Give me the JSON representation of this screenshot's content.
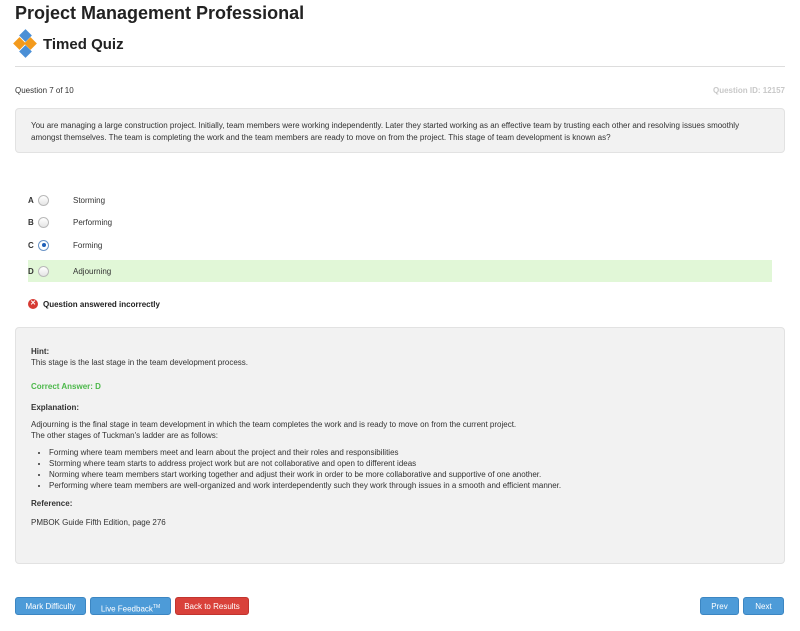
{
  "header": {
    "app_title": "Project Management Professional",
    "quiz_title": "Timed Quiz"
  },
  "question": {
    "counter": "Question 7 of 10",
    "id": "Question ID: 12157",
    "text": "You are managing a large construction project. Initially, team members were working independently. Later they started working as an effective team by trusting each other and resolving issues smoothly amongst themselves. The team is completing the work and the team members are ready to move on from the project. This stage of team development is known as?"
  },
  "options": [
    {
      "letter": "A",
      "label": "Storming",
      "selected": false,
      "correct": false
    },
    {
      "letter": "B",
      "label": "Performing",
      "selected": false,
      "correct": false
    },
    {
      "letter": "C",
      "label": "Forming",
      "selected": true,
      "correct": false
    },
    {
      "letter": "D",
      "label": "Adjourning",
      "selected": false,
      "correct": true
    }
  ],
  "feedback": {
    "icon": "x-circle-icon",
    "text": "Question answered incorrectly"
  },
  "hint": {
    "label": "Hint:",
    "text": "This stage is the last stage in the team development process.",
    "correct_answer": "Correct Answer: D",
    "explanation_label": "Explanation:",
    "explanation_line1": "Adjourning is the final stage in team development in which the team completes the work and is ready to move on from the current project.",
    "explanation_line2": "The other stages of Tuckman's ladder are as follows:",
    "bullets": [
      "Forming where team members meet and learn about the project and their roles and responsibilities",
      "Storming where team starts to address project work but are not collaborative and open to different ideas",
      "Norming where team members start working together and adjust their work in order to be more collaborative and supportive of one another.",
      "Performing where team members are well-organized and work interdependently such they work through issues in a smooth and efficient manner."
    ],
    "reference_label": "Reference:",
    "reference_text": "PMBOK Guide Fifth Edition, page 276"
  },
  "buttons": {
    "mark_difficulty": "Mark Difficulty",
    "live_feedback": "Live Feedback",
    "live_feedback_tm": "TM",
    "back_to_results": "Back to Results",
    "prev": "Prev",
    "next": "Next"
  },
  "colors": {
    "accent_blue": "#4d9bd8",
    "danger_red": "#d9413a",
    "correct_green": "#4cb84a",
    "correct_highlight": "#e1f7d7"
  }
}
